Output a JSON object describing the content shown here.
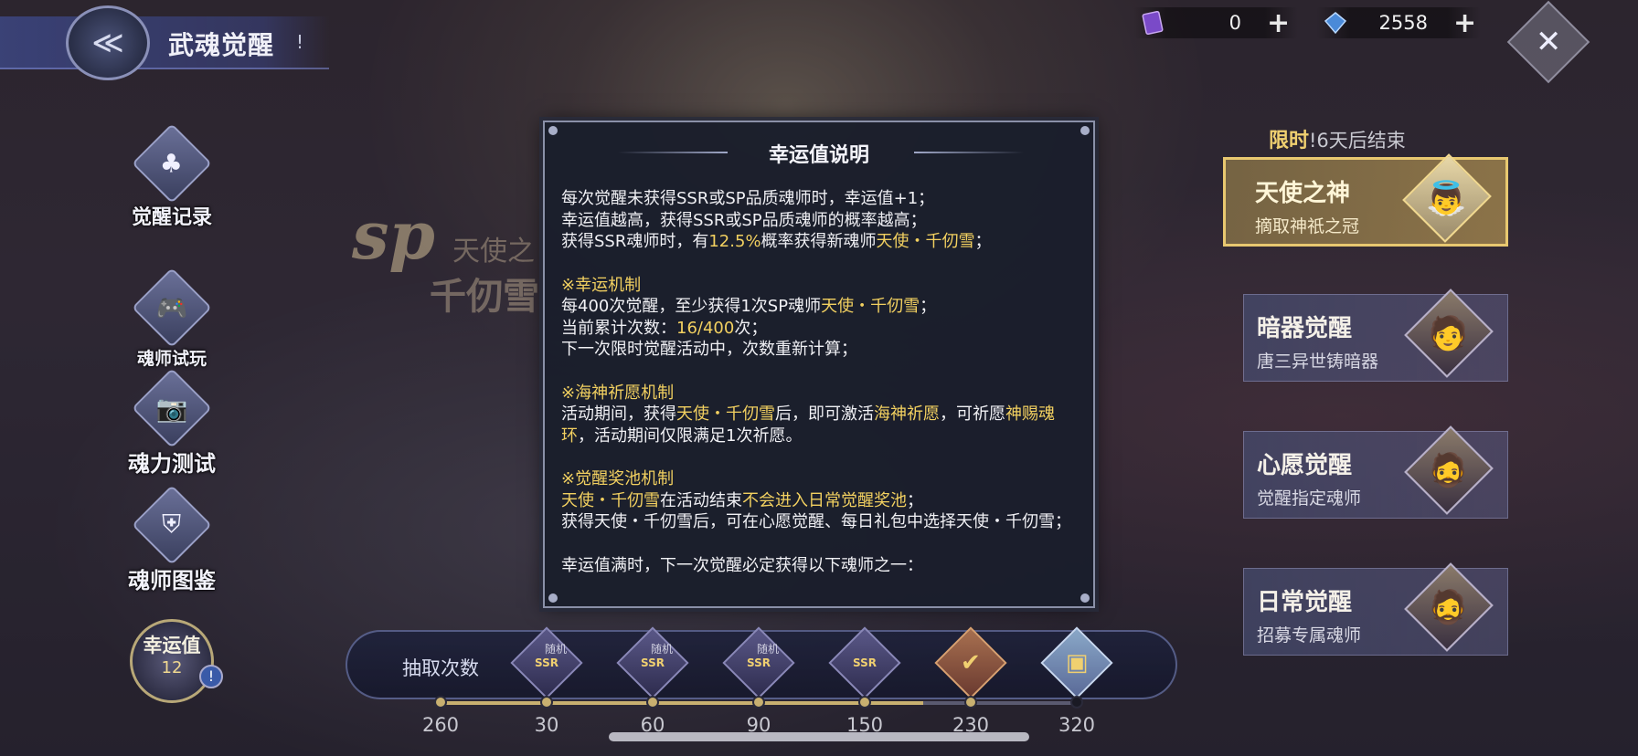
{
  "header": {
    "title": "武魂觉醒",
    "info_label": "!",
    "back_label": "≪"
  },
  "currency": [
    {
      "icon": "purple-ticket-icon",
      "value": "0",
      "plus": "+"
    },
    {
      "icon": "blue-diamond-icon",
      "value": "2558",
      "plus": "+"
    }
  ],
  "left_menu": [
    {
      "label": "觉醒记录",
      "icon": "record-cards-icon"
    },
    {
      "label": "魂师试玩",
      "icon": "gamepad-icon"
    },
    {
      "label": "魂力测试",
      "icon": "camera-icon"
    },
    {
      "label": "魂师图鉴",
      "icon": "helmet-icon"
    }
  ],
  "luck": {
    "label": "幸运值",
    "value": "12",
    "info": "!"
  },
  "banner_art": {
    "sp": "sp",
    "sub1": "天使之",
    "sub2": "千仞雪"
  },
  "limited": {
    "tag": "限时",
    "text": "!6天后结束"
  },
  "banners": [
    {
      "title": "天使之神",
      "subtitle": "摘取神祇之冠",
      "active": true
    },
    {
      "title": "暗器觉醒",
      "subtitle": "唐三异世铸暗器",
      "active": false
    },
    {
      "title": "心愿觉醒",
      "subtitle": "觉醒指定魂师",
      "active": false
    },
    {
      "title": "日常觉醒",
      "subtitle": "招募专属魂师",
      "active": false
    }
  ],
  "draw_bar": {
    "label": "抽取次数",
    "current": "260",
    "progress_fraction": 0.76,
    "milestones": [
      {
        "count": "30",
        "tag": "随机",
        "badge": "SSR"
      },
      {
        "count": "60",
        "tag": "随机",
        "badge": "SSR"
      },
      {
        "count": "90",
        "tag": "随机",
        "badge": "SSR"
      },
      {
        "count": "150",
        "tag": "",
        "badge": "SSR"
      },
      {
        "count": "230",
        "tag": "",
        "badge": ""
      },
      {
        "count": "320",
        "tag": "",
        "badge": ""
      }
    ]
  },
  "modal": {
    "title": "幸运值说明",
    "intro": [
      "每次觉醒未获得SSR或SP品质魂师时，幸运值+1；",
      "幸运值越高，获得SSR或SP品质魂师的概率越高；"
    ],
    "intro3_a": "获得SSR魂师时，有",
    "intro3_b": "12.5%",
    "intro3_c": "概率获得新魂师",
    "intro3_d": "天使・千仞雪",
    "intro3_e": "；",
    "sec1_title": "※幸运机制",
    "sec1_l1_a": "每400次觉醒，至少获得1次SP魂师",
    "sec1_l1_b": "天使・千仞雪",
    "sec1_l1_c": "；",
    "sec1_l2_a": "当前累计次数：",
    "sec1_l2_b": "16/400",
    "sec1_l2_c": "次；",
    "sec1_l3": "下一次限时觉醒活动中，次数重新计算；",
    "sec2_title": "※海神祈愿机制",
    "sec2_a": "活动期间，获得",
    "sec2_b": "天使・千仞雪",
    "sec2_c": "后，即可激活",
    "sec2_d": "海神祈愿",
    "sec2_e": "，可祈愿",
    "sec2_f": "神赐魂环",
    "sec2_g": "，活动期间仅限满足1次祈愿。",
    "sec3_title": "※觉醒奖池机制",
    "sec3_a": "天使・千仞雪",
    "sec3_b": "在活动结束",
    "sec3_c": "不会进入日常觉醒奖池",
    "sec3_d": "；",
    "sec3_l2": "获得天使・千仞雪后，可在心愿觉醒、每日礼包中选择天使・千仞雪；",
    "last_line": "幸运值满时，下一次觉醒必定获得以下魂师之一："
  }
}
